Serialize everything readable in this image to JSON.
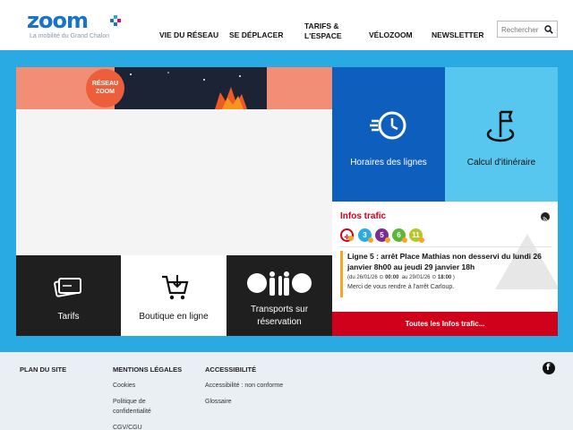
{
  "header": {
    "logo_text": "zoom",
    "logo_tagline": "La mobilité du Grand Chalon",
    "nav": [
      {
        "label": "VIE DU RÉSEAU"
      },
      {
        "label": "SE DÉPLACER"
      },
      {
        "label": "TARIFS &\nL'ESPACE"
      },
      {
        "label": "VÉLOZOOM"
      },
      {
        "label": "NEWSLETTER"
      }
    ],
    "search_placeholder": "Rechercher"
  },
  "banner": {
    "badge_text": "RÉSEAU\nZOOM"
  },
  "tiles": {
    "horaires": "Horaires des lignes",
    "itineraire": "Calcul d'itinéraire",
    "tarifs": "Tarifs",
    "boutique": "Boutique en ligne",
    "transports": "Transports sur\nréservation"
  },
  "infos": {
    "title": "Infos trafic",
    "lines": [
      {
        "label": "",
        "color": "#ffffff",
        "border": "#d0021b"
      },
      {
        "label": "3",
        "color": "#29aae2"
      },
      {
        "label": "5",
        "color": "#7b2d8e"
      },
      {
        "label": "6",
        "color": "#5fb535"
      },
      {
        "label": "11",
        "color": "#b5c82a"
      }
    ],
    "alert_title": "Ligne 5 : arrêt Place Mathias non desservi du lundi 26 janvier 8h00 au jeudi 29 janvier 18h",
    "alert_from_label": "du",
    "alert_from_date": "26/01/26",
    "alert_from_time": "00:00",
    "alert_to_label": "au",
    "alert_to_date": "29/01/26",
    "alert_to_time": "18:00",
    "alert_message": "Merci de vous rendre à l'arrêt Carloup.",
    "all_link": "Toutes les Infos trafic..."
  },
  "footer": {
    "plan": "PLAN DU SITE",
    "mentions": "MENTIONS LÉGALES",
    "mentions_links": [
      "Cookies",
      "Politique de\nconfidentialité",
      "CGV/CGU"
    ],
    "accessibilite": "ACCESSIBILITÉ",
    "access_links": [
      "Accessibilité : non conforme",
      "Glossaire"
    ]
  },
  "colors": {
    "brand_blue": "#1a74c4",
    "band_blue": "#29aae2",
    "dark_tile": "#1f1f1f",
    "horaires_blue": "#0e5fbd",
    "itineraire_blue": "#58c7f0",
    "alert_red": "#d0021b"
  },
  "icons": [
    "clock-rewind-icon",
    "flag-location-icon",
    "ticket-icon",
    "cart-icon",
    "reservation-logo-icon",
    "rss-icon",
    "facebook-icon",
    "search-icon",
    "warning-icon"
  ]
}
